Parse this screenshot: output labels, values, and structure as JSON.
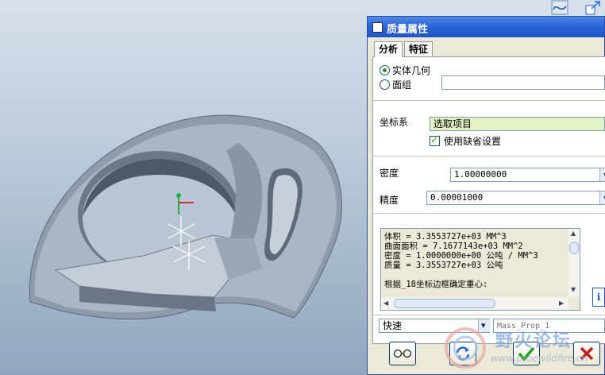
{
  "dialog": {
    "title": "质量属性",
    "tabs": [
      "分析",
      "特征"
    ],
    "geometry": {
      "solid_label": "实体几何",
      "solid_selected": true,
      "surface_label": "面组",
      "surface_value": ""
    },
    "coord": {
      "label": "坐标系",
      "select_value": "选取项目",
      "default_label": "使用缺省设置",
      "default_checked": true
    },
    "density": {
      "label": "密度",
      "value": "1.00000000"
    },
    "precision": {
      "label": "精度",
      "value": "0.00001000"
    },
    "results": [
      "体积 =  3.3553727e+03  MM^3",
      "曲面面积 =  7.1677143e+03  MM^2",
      "密度 =  1.0000000e+00 公吨 / MM^3",
      "质量 =  3.3553727e+03 公吨",
      "根据_18坐标边框确定重心:"
    ],
    "mode": {
      "value": "快速"
    },
    "name_placeholder": "Mass_Prop_1",
    "buttons": {
      "preview": "glasses-icon",
      "repeat": "cycle-icon",
      "ok": "checkmark-icon",
      "cancel": "x-icon"
    }
  },
  "watermark": {
    "text": "野火论坛",
    "url": "www.proewildfire.cn"
  },
  "colors": {
    "title_bar": "#2a63d6",
    "dialog_bg": "#ece9d8",
    "select_green": "#e2f2c4",
    "ok_green": "#21a121",
    "cancel_red": "#c0201e"
  }
}
